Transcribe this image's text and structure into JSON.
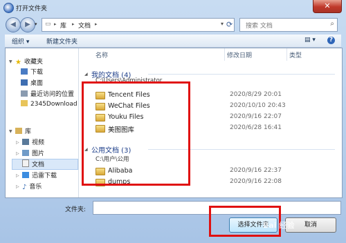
{
  "window": {
    "title": "打开文件夹",
    "close_glyph": "✕"
  },
  "navbar": {
    "back_glyph": "◀",
    "forward_glyph": "▶",
    "drop_glyph": "▾",
    "breadcrumb": [
      "库",
      "文档"
    ],
    "sep_glyph": "▸",
    "refresh_glyph": "⟳",
    "search_placeholder": "搜索 文档",
    "search_glyph": "⌕"
  },
  "toolbar": {
    "organize": "组织 ▾",
    "new_folder": "新建文件夹",
    "view_glyph": "▤ ▾",
    "help_glyph": "?"
  },
  "nav_pane": {
    "favorites": "收藏夹",
    "fav_items": [
      "下载",
      "桌面",
      "最近访问的位置",
      "2345Download"
    ],
    "library": "库",
    "lib_items": [
      "视频",
      "图片",
      "文档",
      "迅雷下载",
      "音乐"
    ]
  },
  "columns": {
    "name": "名称",
    "modified": "修改日期",
    "type": "类型"
  },
  "groups": [
    {
      "title": "我的文档 (4)",
      "path": "C:\\Users\\Administrator",
      "items": [
        {
          "name": "Tencent Files",
          "date": "2020/8/29 20:01"
        },
        {
          "name": "WeChat Files",
          "date": "2020/10/10 20:43"
        },
        {
          "name": "Youku Files",
          "date": "2020/9/16 22:07"
        },
        {
          "name": "美图图库",
          "date": "2020/6/28 16:41"
        }
      ]
    },
    {
      "title": "公用文档 (3)",
      "path": "C:\\用户\\公用",
      "items": [
        {
          "name": "Alibaba",
          "date": "2020/9/16 22:37"
        },
        {
          "name": "dumps",
          "date": "2020/9/16 22:08"
        }
      ]
    }
  ],
  "footer": {
    "folder_label": "文件夹:",
    "select_button": "选择文件夹",
    "cancel_button": "取消"
  },
  "watermark": "Bai 经验",
  "colors": {
    "highlight": "#e01010"
  }
}
